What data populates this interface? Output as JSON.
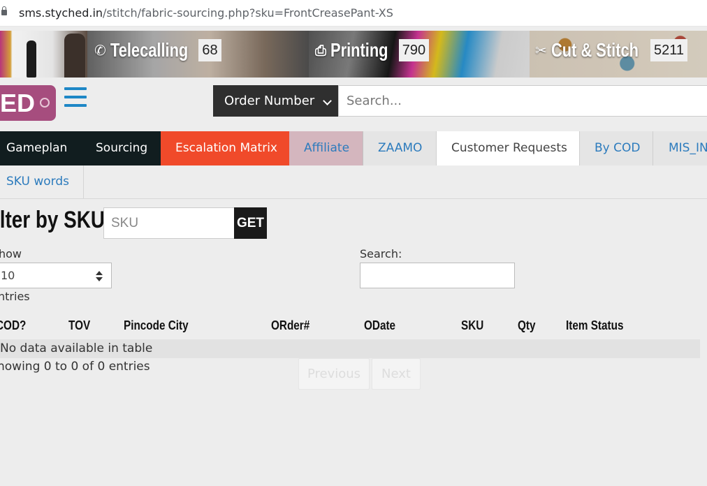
{
  "browser": {
    "url_host": "sms.styched.in",
    "url_path": "/stitch/fabric-sourcing.php?sku=FrontCreasePant-XS"
  },
  "banner": {
    "items": [
      {
        "icon": "phone-icon",
        "label": "Telecalling",
        "count": "68"
      },
      {
        "icon": "printer-icon",
        "label": "Printing",
        "count": "790"
      },
      {
        "icon": "scissors-icon",
        "label": "Cut & Stitch",
        "count": "5211"
      }
    ]
  },
  "logo": {
    "text": "ED"
  },
  "search": {
    "type_label": "Order Number",
    "placeholder": "Search..."
  },
  "nav": {
    "tabs": [
      {
        "label": "Gameplan"
      },
      {
        "label": "Sourcing"
      },
      {
        "label": "Escalation Matrix"
      },
      {
        "label": "Affiliate"
      },
      {
        "label": "ZAAMO"
      },
      {
        "label": "Customer Requests"
      },
      {
        "label": "By COD"
      },
      {
        "label": "MIS_IN"
      }
    ],
    "row2": [
      {
        "label": "SKU words"
      }
    ]
  },
  "filter": {
    "title": "ilter by SKU",
    "sku_placeholder": "SKU",
    "get_label": "GET"
  },
  "table_controls": {
    "show_label": "how",
    "show_value": "10",
    "entries_label": "ntries",
    "search_label": "Search:"
  },
  "table": {
    "columns": [
      "COD?",
      "TOV",
      "Pincode City",
      "ORder#",
      "ODate",
      "SKU",
      "Qty",
      "Item Status"
    ],
    "empty_message": "No data available in table",
    "info": "howing 0 to 0 of 0 entries",
    "prev_label": "Previous",
    "next_label": "Next"
  },
  "colors": {
    "accent_blue": "#2c7bbd",
    "escalation_red": "#f04a2a",
    "dark_tab": "#111d1f",
    "logo_purple": "#a64d7e",
    "affiliate_pink": "#d4b6be"
  }
}
